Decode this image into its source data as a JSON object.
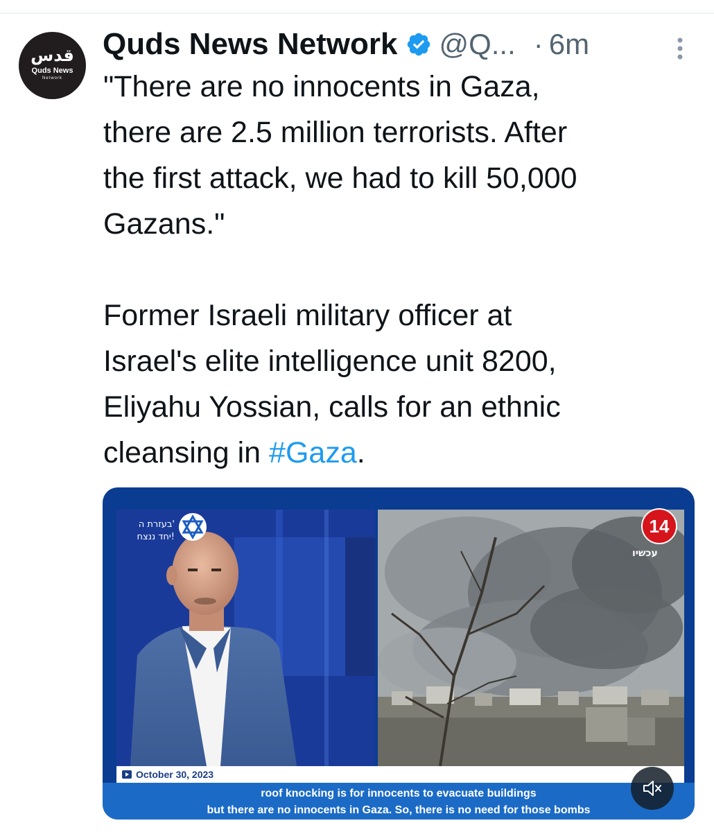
{
  "author": {
    "avatar_logo_arabic": "قدس",
    "avatar_logo_text": "Quds News",
    "avatar_logo_sub": "Network",
    "display_name": "Quds News Network",
    "handle": "@Q...",
    "separator": "·",
    "time": "6m",
    "verified_icon": "verified-badge-icon",
    "verified_color": "#1d9bf0"
  },
  "tweet": {
    "quote_lines": [
      "\"There are no innocents in Gaza,",
      "there are 2.5 million terrorists. After",
      "the first attack, we had to kill 50,000",
      "Gazans.\""
    ],
    "body_lines": [
      "Former Israeli military officer at",
      "Israel's elite intelligence unit 8200,",
      "Eliyahu Yossian, calls for an ethnic"
    ],
    "last_line_prefix": "cleansing in ",
    "hashtag": "#Gaza",
    "last_line_suffix": ".",
    "hashtag_color": "#1d9bf0"
  },
  "media": {
    "type": "video",
    "date": "October 30, 2023",
    "caption_line_1": "roof knocking is for innocents to evacuate buildings",
    "caption_line_2": "but there are no innocents in Gaza. So, there is no need for those bombs",
    "channel_number": "14",
    "channel_sub": "עכשיו",
    "overlay_hebrew_1": "בעזרת ה'",
    "overlay_hebrew_2": "יחד ננצח!",
    "mute_icon": "speaker-muted-icon",
    "caption_color": "#1b6bc6"
  }
}
